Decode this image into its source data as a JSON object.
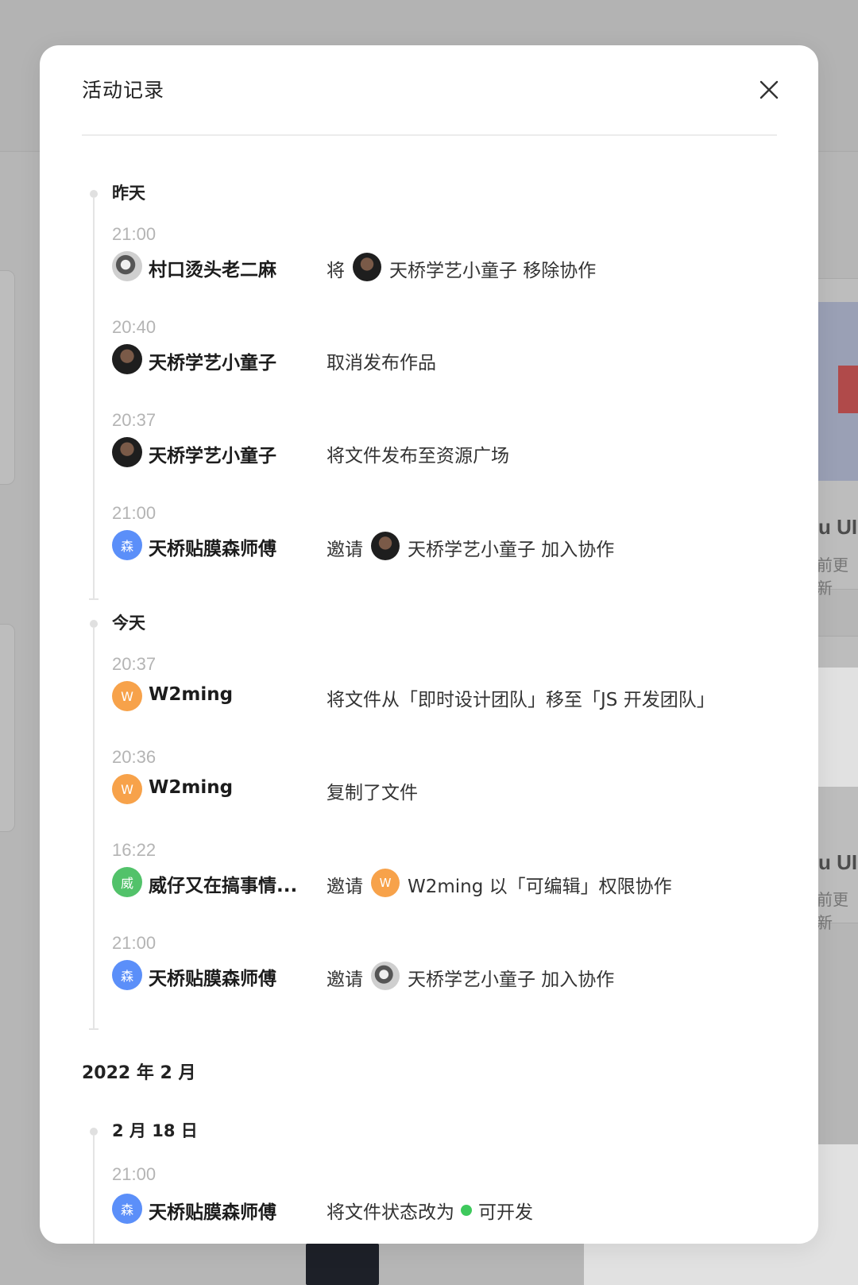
{
  "modal": {
    "title": "活动记录",
    "close_label": "关闭"
  },
  "background": {
    "card_title_1": "u UI",
    "card_sub_1": "前更新",
    "card_title_2": "u UI",
    "card_sub_2": "前更新"
  },
  "groups": [
    {
      "day": "昨天",
      "entries": [
        {
          "time": "21:00",
          "user": "村口烫头老二麻",
          "avatar": "photo-alt",
          "avatar_text": "",
          "action_before": "将",
          "target_avatar": "photo",
          "target_avatar_text": "",
          "action_after": "天桥学艺小童子 移除协作"
        },
        {
          "time": "20:40",
          "user": "天桥学艺小童子",
          "avatar": "photo",
          "avatar_text": "",
          "action_before": "取消发布作品",
          "target_avatar": "",
          "target_avatar_text": "",
          "action_after": ""
        },
        {
          "time": "20:37",
          "user": "天桥学艺小童子",
          "avatar": "photo",
          "avatar_text": "",
          "action_before": "将文件发布至资源广场",
          "target_avatar": "",
          "target_avatar_text": "",
          "action_after": ""
        },
        {
          "time": "21:00",
          "user": "天桥贴膜森师傅",
          "avatar": "blue",
          "avatar_text": "森",
          "action_before": "邀请",
          "target_avatar": "photo",
          "target_avatar_text": "",
          "action_after": "天桥学艺小童子 加入协作"
        }
      ]
    },
    {
      "day": "今天",
      "entries": [
        {
          "time": "20:37",
          "user": "W2ming",
          "avatar": "orange",
          "avatar_text": "W",
          "action_before": "将文件从「即时设计团队」移至「JS 开发团队」",
          "target_avatar": "",
          "target_avatar_text": "",
          "action_after": ""
        },
        {
          "time": "20:36",
          "user": "W2ming",
          "avatar": "orange",
          "avatar_text": "W",
          "action_before": "复制了文件",
          "target_avatar": "",
          "target_avatar_text": "",
          "action_after": ""
        },
        {
          "time": "16:22",
          "user": "威仔又在搞事情...",
          "avatar": "green",
          "avatar_text": "威",
          "action_before": "邀请",
          "target_avatar": "orange",
          "target_avatar_text": "W",
          "action_after": "W2ming 以「可编辑」权限协作"
        },
        {
          "time": "21:00",
          "user": "天桥贴膜森师傅",
          "avatar": "blue",
          "avatar_text": "森",
          "action_before": "邀请",
          "target_avatar": "photo-alt",
          "target_avatar_text": "",
          "action_after": "天桥学艺小童子 加入协作"
        }
      ]
    }
  ],
  "month": "2022 年 2 月",
  "month_group": {
    "day": "2 月 18 日",
    "entry": {
      "time": "21:00",
      "user": "天桥贴膜森师傅",
      "avatar": "blue",
      "avatar_text": "森",
      "action_before": "将文件状态改为",
      "status": "可开发"
    }
  },
  "colors": {
    "blue": "#5b8ff9",
    "orange": "#f7a24a",
    "green": "#52c26a",
    "status_green": "#3ec95c"
  }
}
